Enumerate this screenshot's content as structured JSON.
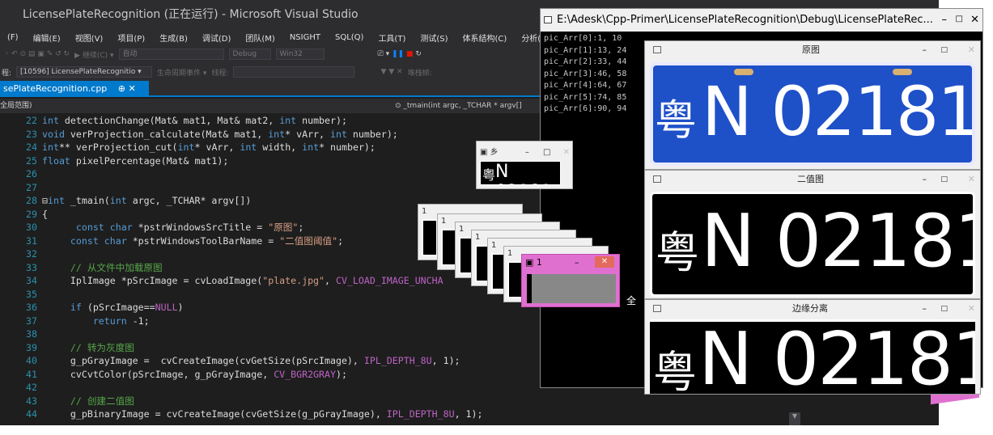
{
  "vs": {
    "title": "LicensePlateRecognition (正在运行) - Microsoft Visual Studio",
    "menu": [
      "(F)",
      "编辑(E)",
      "视图(V)",
      "项目(P)",
      "生成(B)",
      "调试(D)",
      "团队(M)",
      "NSIGHT",
      "SQL(Q)",
      "工具(T)",
      "测试(S)",
      "体系结构(C)",
      "分析(N"
    ],
    "toolbar": {
      "continue": "▶ 继续(C) ▾",
      "auto": "自动",
      "config": "Debug",
      "platform": "Win32"
    },
    "toolbar2": {
      "process_label": "程:",
      "process": "[10596] LicensePlateRecognitio ▾",
      "lifecycle": "生命周期事件 ▾",
      "thread_label": "线程:",
      "stack": "堆栈帧:"
    },
    "tab": {
      "label": "sePlateRecognition.cpp",
      "pin": "⊕ ✕"
    },
    "nav": {
      "scope": "全局范围)",
      "function": "⊙ _tmain(int argc, _TCHAR * argv[]"
    },
    "code_lines": [
      {
        "n": "22",
        "t": "int detectionChange(Mat& mat1, Mat& mat2, int number);"
      },
      {
        "n": "23",
        "t": "void verProjection_calculate(Mat& mat1, int* vArr, int number);"
      },
      {
        "n": "24",
        "t": "int** verProjection_cut(int* vArr, int width, int* number);"
      },
      {
        "n": "25",
        "t": "float pixelPercentage(Mat& mat1);"
      },
      {
        "n": "26",
        "t": ""
      },
      {
        "n": "27",
        "t": ""
      },
      {
        "n": "28",
        "t": "⊟int _tmain(int argc, _TCHAR* argv[])"
      },
      {
        "n": "29",
        "t": "{"
      },
      {
        "n": "30",
        "t": "      const char *pstrWindowsSrcTitle = \"原图\";"
      },
      {
        "n": "31",
        "t": "     const char *pstrWindowsToolBarName = \"二值图阈值\";"
      },
      {
        "n": "32",
        "t": ""
      },
      {
        "n": "33",
        "t": "     // 从文件中加载原图"
      },
      {
        "n": "34",
        "t": "     IplImage *pSrcImage = cvLoadImage(\"plate.jpg\", CV_LOAD_IMAGE_UNCHA"
      },
      {
        "n": "35",
        "t": ""
      },
      {
        "n": "36",
        "t": "     if (pSrcImage==NULL)"
      },
      {
        "n": "37",
        "t": "         return -1;"
      },
      {
        "n": "38",
        "t": ""
      },
      {
        "n": "39",
        "t": "     // 转为灰度图"
      },
      {
        "n": "40",
        "t": "     g_pGrayImage =  cvCreateImage(cvGetSize(pSrcImage), IPL_DEPTH_8U, 1);"
      },
      {
        "n": "41",
        "t": "     cvCvtColor(pSrcImage, g_pGrayImage, CV_BGR2GRAY);"
      },
      {
        "n": "42",
        "t": ""
      },
      {
        "n": "43",
        "t": "     // 创建二值图"
      },
      {
        "n": "44",
        "t": "     g_pBinaryImage = cvCreateImage(cvGetSize(g_pGrayImage), IPL_DEPTH_8U, 1);"
      }
    ],
    "console": {
      "title": "E:\\Adesk\\Cpp-Primer\\LicensePlateRecognition\\Debug\\LicensePlateRec...",
      "lines": [
        "pic_Arr[0]:1, 10",
        "pic_Arr[1]:13, 24",
        "pic_Arr[2]:33, 44",
        "pic_Arr[3]:46, 58",
        "pic_Arr[4]:64, 67",
        "pic_Arr[5]:74, 85",
        "pic_Arr[6]:90, 94"
      ]
    },
    "windows": {
      "original": "原图",
      "binary": "二值图",
      "edge": "边缘分离",
      "small_title": "1",
      "tiny": "乡",
      "overlay_char": "全"
    },
    "plate": {
      "province": "粤",
      "text": "N·02181",
      "text_plain": "N 02181"
    },
    "colors": {
      "plate_blue": "#1e50c8",
      "vs_bg": "#1e1e1e",
      "accent": "#007acc",
      "pink": "#e070d0"
    }
  }
}
